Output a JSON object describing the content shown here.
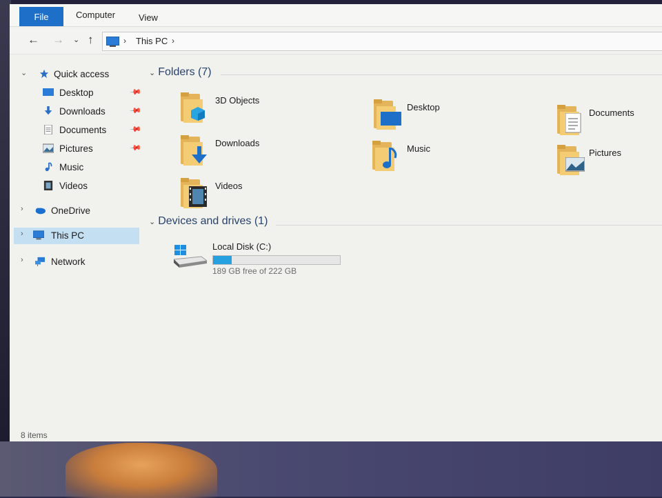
{
  "ribbon": {
    "file": "File",
    "computer": "Computer",
    "view": "View"
  },
  "address": {
    "crumbs": [
      "This PC"
    ]
  },
  "nav": {
    "items": [
      {
        "label": "Quick access",
        "icon": "star-icon"
      },
      {
        "label": "Desktop",
        "icon": "desktop-icon",
        "pinned": true
      },
      {
        "label": "Downloads",
        "icon": "download-arrow-icon",
        "pinned": true
      },
      {
        "label": "Documents",
        "icon": "document-icon",
        "pinned": true
      },
      {
        "label": "Pictures",
        "icon": "picture-icon",
        "pinned": true
      },
      {
        "label": "Music",
        "icon": "music-note-icon"
      },
      {
        "label": "Videos",
        "icon": "film-icon"
      },
      {
        "label": "OneDrive",
        "icon": "cloud-icon"
      },
      {
        "label": "This PC",
        "icon": "computer-icon",
        "selected": true
      },
      {
        "label": "Network",
        "icon": "network-icon"
      }
    ]
  },
  "folders": {
    "header": "Folders (7)",
    "items": [
      {
        "label": "3D Objects"
      },
      {
        "label": "Desktop"
      },
      {
        "label": "Documents"
      },
      {
        "label": "Downloads"
      },
      {
        "label": "Music"
      },
      {
        "label": "Pictures"
      },
      {
        "label": "Videos"
      }
    ]
  },
  "devices": {
    "header": "Devices and drives (1)",
    "drive": {
      "name": "Local Disk (C:)",
      "free_text": "189 GB free of 222 GB",
      "used_fraction": 0.149
    }
  },
  "status": {
    "items": "8 items"
  },
  "colors": {
    "accent": "#1e6fc7",
    "selection": "#c5dff2",
    "drive_bar": "#27a0e0",
    "folder": "#f4cc73"
  }
}
